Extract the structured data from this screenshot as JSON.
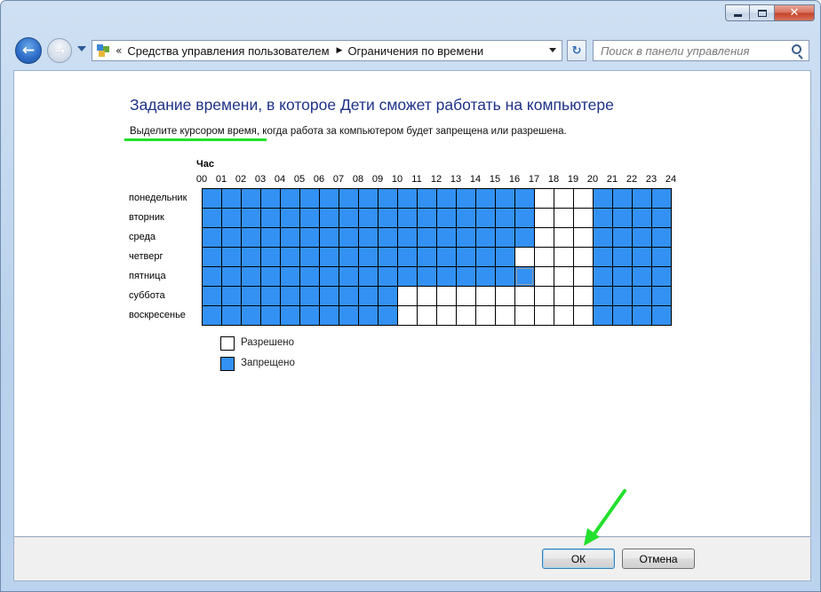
{
  "window": {
    "minimize_label": "–",
    "close_label": "✕"
  },
  "nav": {
    "back_glyph": "←",
    "forward_glyph": "→",
    "address_sep": "«",
    "breadcrumbs": [
      {
        "label": "Средства управления пользователем"
      },
      {
        "label": "Ограничения по времени"
      }
    ],
    "refresh_glyph": "↻",
    "search_placeholder": "Поиск в панели управления"
  },
  "main": {
    "title": "Задание времени, в которое Дети сможет работать на компьютере",
    "instruction": "Выделите курсором время, когда работа за компьютером будет запрещена или разрешена.",
    "hour_caption": "Час",
    "hours": [
      "00",
      "01",
      "02",
      "03",
      "04",
      "05",
      "06",
      "07",
      "08",
      "09",
      "10",
      "11",
      "12",
      "13",
      "14",
      "15",
      "16",
      "17",
      "18",
      "19",
      "20",
      "21",
      "22",
      "23",
      "24"
    ],
    "days": [
      {
        "label": "понедельник",
        "blocked": [
          1,
          1,
          1,
          1,
          1,
          1,
          1,
          1,
          1,
          1,
          1,
          1,
          1,
          1,
          1,
          1,
          1,
          0,
          0,
          0,
          1,
          1,
          1,
          1
        ]
      },
      {
        "label": "вторник",
        "blocked": [
          1,
          1,
          1,
          1,
          1,
          1,
          1,
          1,
          1,
          1,
          1,
          1,
          1,
          1,
          1,
          1,
          1,
          0,
          0,
          0,
          1,
          1,
          1,
          1
        ]
      },
      {
        "label": "среда",
        "blocked": [
          1,
          1,
          1,
          1,
          1,
          1,
          1,
          1,
          1,
          1,
          1,
          1,
          1,
          1,
          1,
          1,
          1,
          0,
          0,
          0,
          1,
          1,
          1,
          1
        ]
      },
      {
        "label": "четверг",
        "blocked": [
          1,
          1,
          1,
          1,
          1,
          1,
          1,
          1,
          1,
          1,
          1,
          1,
          1,
          1,
          1,
          1,
          0,
          0,
          0,
          0,
          1,
          1,
          1,
          1
        ]
      },
      {
        "label": "пятница",
        "blocked": [
          1,
          1,
          1,
          1,
          1,
          1,
          1,
          1,
          1,
          1,
          1,
          1,
          1,
          1,
          1,
          1,
          1,
          0,
          0,
          0,
          1,
          1,
          1,
          1
        ]
      },
      {
        "label": "суббота",
        "blocked": [
          1,
          1,
          1,
          1,
          1,
          1,
          1,
          1,
          1,
          1,
          0,
          0,
          0,
          0,
          0,
          0,
          0,
          0,
          0,
          0,
          1,
          1,
          1,
          1
        ]
      },
      {
        "label": "воскресенье",
        "blocked": [
          1,
          1,
          1,
          1,
          1,
          1,
          1,
          1,
          1,
          1,
          0,
          0,
          0,
          0,
          0,
          0,
          0,
          0,
          0,
          0,
          1,
          1,
          1,
          1
        ]
      }
    ],
    "legend": [
      {
        "label": "Разрешено",
        "color": "#ffffff"
      },
      {
        "label": "Запрещено",
        "color": "#3391f4"
      }
    ],
    "blocked_color": "#3391f4"
  },
  "footer": {
    "ok_label": "ОК",
    "cancel_label": "Отмена"
  },
  "annotations": {
    "highlight_color": "#22e02c"
  }
}
